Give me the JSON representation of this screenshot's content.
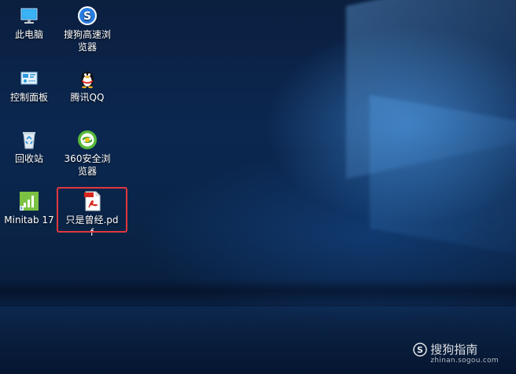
{
  "desktop": {
    "icons": [
      {
        "id": "this-pc",
        "label": "此电脑",
        "icon": "monitor-icon"
      },
      {
        "id": "sogou-browser",
        "label": "搜狗高速浏览器",
        "icon": "sogou-browser-icon"
      },
      {
        "id": "control-panel",
        "label": "控制面板",
        "icon": "control-panel-icon"
      },
      {
        "id": "tencent-qq",
        "label": "腾讯QQ",
        "icon": "qq-penguin-icon"
      },
      {
        "id": "recycle-bin",
        "label": "回收站",
        "icon": "recycle-bin-icon"
      },
      {
        "id": "360-browser",
        "label": "360安全浏览器",
        "icon": "360-browser-icon"
      },
      {
        "id": "minitab",
        "label": "Minitab 17",
        "icon": "minitab-icon"
      },
      {
        "id": "pdf-file",
        "label": "只是曾经.pdf",
        "icon": "pdf-file-icon",
        "badge": "PDF"
      }
    ],
    "selected_icon": "pdf-file"
  },
  "watermark": {
    "text": "搜狗指南",
    "domain": "zhinan.sogou.com"
  },
  "colors": {
    "highlight": "#e0383e",
    "sogou_blue": "#2a7de1",
    "minitab_green": "#7cc242",
    "pdf_red": "#d9261c"
  }
}
